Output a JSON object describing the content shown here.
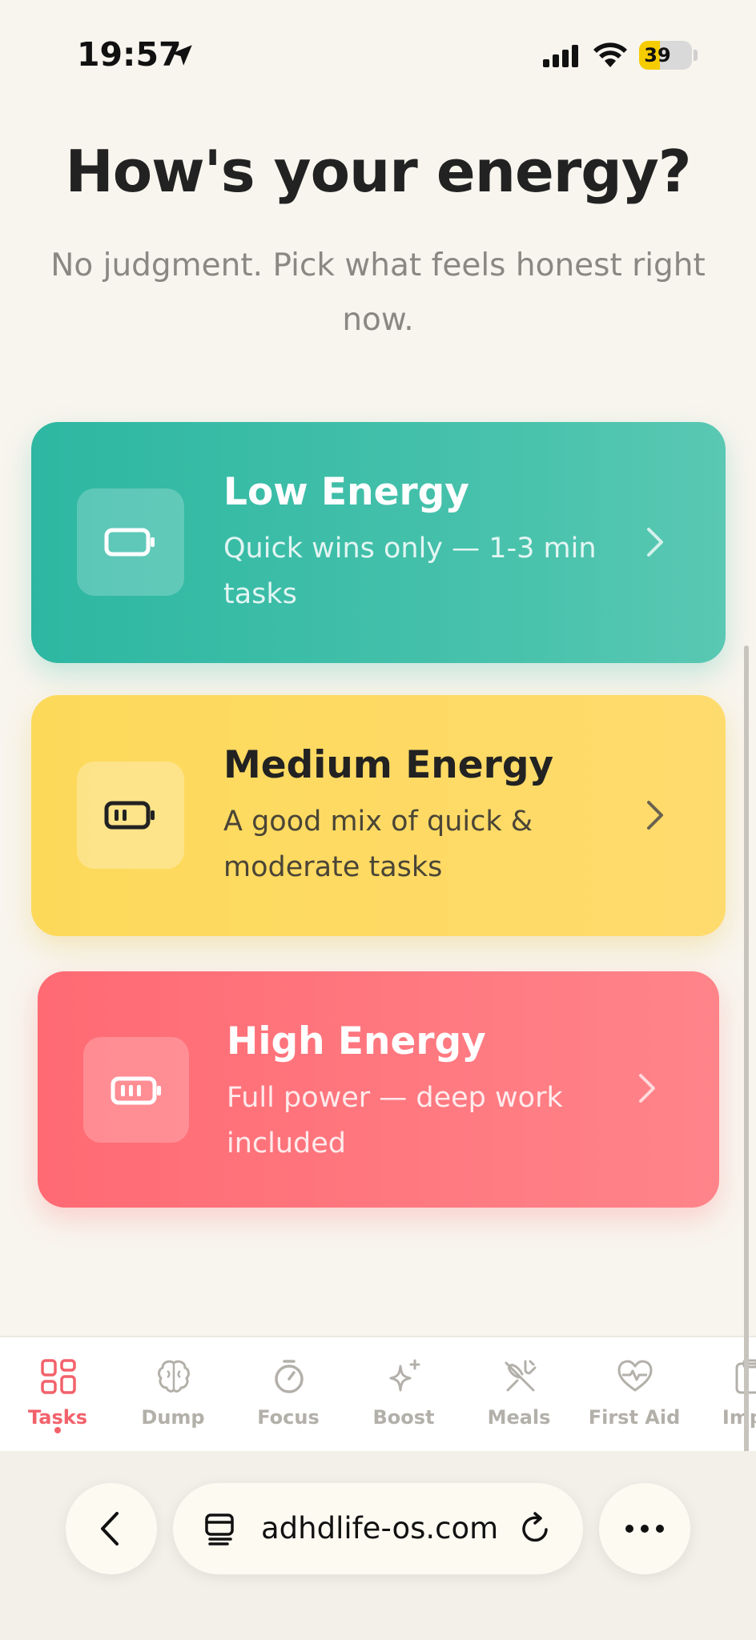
{
  "status_bar": {
    "time": "19:57",
    "battery_level": 39,
    "battery_text": "39"
  },
  "header": {
    "title": "How's your energy?",
    "subtitle": "No judgment. Pick what feels honest right now."
  },
  "energy_options": [
    {
      "title": "Low Energy",
      "description": "Quick wins only — 1-3 min tasks",
      "color": "#2db7a2",
      "icon": "battery-low-icon"
    },
    {
      "title": "Medium Energy",
      "description": "A good mix of quick & moderate tasks",
      "color": "#fdd95a",
      "icon": "battery-medium-icon"
    },
    {
      "title": "High Energy",
      "description": "Full power — deep work included",
      "color": "#ff6a73",
      "icon": "battery-full-icon"
    }
  ],
  "tab_bar": {
    "active": "Tasks",
    "accent_color": "#f2626b",
    "tabs": [
      {
        "label": "Tasks",
        "icon": "grid-icon"
      },
      {
        "label": "Dump",
        "icon": "brain-icon"
      },
      {
        "label": "Focus",
        "icon": "timer-icon"
      },
      {
        "label": "Boost",
        "icon": "sparkle-icon"
      },
      {
        "label": "Meals",
        "icon": "utensils-icon"
      },
      {
        "label": "First Aid",
        "icon": "heart-pulse-icon"
      },
      {
        "label": "Impu",
        "icon": "clipboard-icon"
      }
    ]
  },
  "browser": {
    "url": "adhdlife-os.com"
  }
}
